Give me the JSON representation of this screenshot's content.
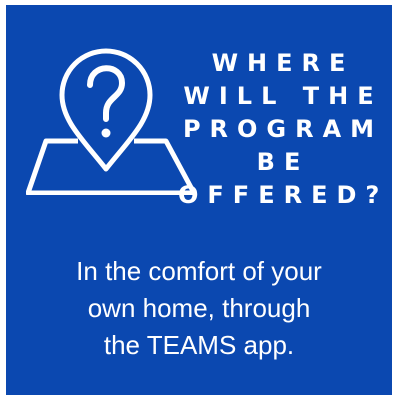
{
  "graphic": {
    "icon": "location-question-pin-icon",
    "background_color": "#0b48b0",
    "heading_lines": [
      "WHERE",
      "WILL THE",
      "PROGRAM",
      "BE",
      "OFFERED?"
    ],
    "answer_lines": [
      "In the comfort of your",
      "own home, through",
      "the TEAMS app."
    ]
  }
}
